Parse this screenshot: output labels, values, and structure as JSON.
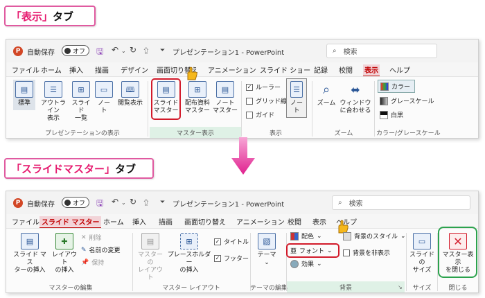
{
  "callouts": {
    "view_tab": {
      "open": "「",
      "name": "表示",
      "close": "」",
      "suffix": "タブ"
    },
    "slide_master_tab": {
      "open": "「",
      "name": "スライドマスター",
      "close": "」",
      "suffix": "タブ"
    }
  },
  "common": {
    "app_icon": "P",
    "autosave_label": "自動保存",
    "autosave_state": "オフ",
    "doc_title": "プレゼンテーション1 - PowerPoint",
    "search_placeholder": "検索"
  },
  "window1": {
    "tabs": [
      "ファイル",
      "ホーム",
      "挿入",
      "描画",
      "デザイン",
      "画面切り替え",
      "アニメーション",
      "スライド ショー",
      "記録",
      "校閲",
      "表示",
      "ヘルプ"
    ],
    "active_tab": "表示",
    "groups": {
      "presentation_views": {
        "label": "プレゼンテーションの表示",
        "normal": "標準",
        "outline": [
          "アウトライン",
          "表示"
        ],
        "sorter": [
          "スライド",
          "一覧"
        ],
        "notes": [
          "ノー",
          "ト"
        ],
        "reading": "閲覧表示"
      },
      "master_views": {
        "label": "マスター表示",
        "slide_master": [
          "スライド",
          "マスター"
        ],
        "handout_master": [
          "配布資料",
          "マスター"
        ],
        "notes_master": [
          "ノート",
          "マスター"
        ]
      },
      "show": {
        "label": "表示",
        "ruler": "ルーラー",
        "gridlines": "グリッド線",
        "guides": "ガイド",
        "notes": [
          "ノー",
          "ト"
        ]
      },
      "zoom": {
        "label": "ズーム",
        "zoom": "ズーム",
        "fit": [
          "ウィンドウ",
          "に合わせる"
        ]
      },
      "color": {
        "label": "カラー/グレースケール",
        "color": "カラー",
        "grayscale": "グレースケール",
        "bw": "白黒"
      }
    }
  },
  "window2": {
    "tabs": [
      "ファイル",
      "スライド マスター",
      "ホーム",
      "挿入",
      "描画",
      "画面切り替え",
      "アニメーション",
      "校閲",
      "表示",
      "ヘルプ"
    ],
    "active_tab": "スライド マスター",
    "groups": {
      "edit_master": {
        "label": "マスターの編集",
        "insert_master": [
          "スライド マス",
          "ターの挿入"
        ],
        "insert_layout": [
          "レイアウト",
          "の挿入"
        ],
        "delete": "削除",
        "rename": "名前の変更",
        "preserve": "保持"
      },
      "master_layout": {
        "label": "マスター レイアウト",
        "master_layout": [
          "マスターの",
          "レイアウト"
        ],
        "placeholder": [
          "プレースホルダー",
          "の挿入"
        ],
        "title": "タイトル",
        "footers": "フッター"
      },
      "edit_theme": {
        "label": "テーマの編集",
        "themes": "テーマ"
      },
      "background": {
        "label": "背景",
        "colors": "配色",
        "fonts": "フォント",
        "effects": "効果",
        "bg_styles": "背景のスタイル",
        "hide_bg": "背景を非表示"
      },
      "size": {
        "label": "サイズ",
        "slide_size": [
          "スライドの",
          "サイズ"
        ]
      },
      "close": {
        "label": "閉じる",
        "close_master": [
          "マスター表示",
          "を閉じる"
        ]
      }
    }
  },
  "colors": {
    "accent_red": "#d21a2a",
    "callout_border": "#e05aa0",
    "highlight_green": "#2ca24d",
    "arrow": "#ee3fa8"
  },
  "icons": [
    "pointing-hand-icon",
    "down-arrow-icon",
    "search-icon",
    "save-icon",
    "undo-icon"
  ]
}
